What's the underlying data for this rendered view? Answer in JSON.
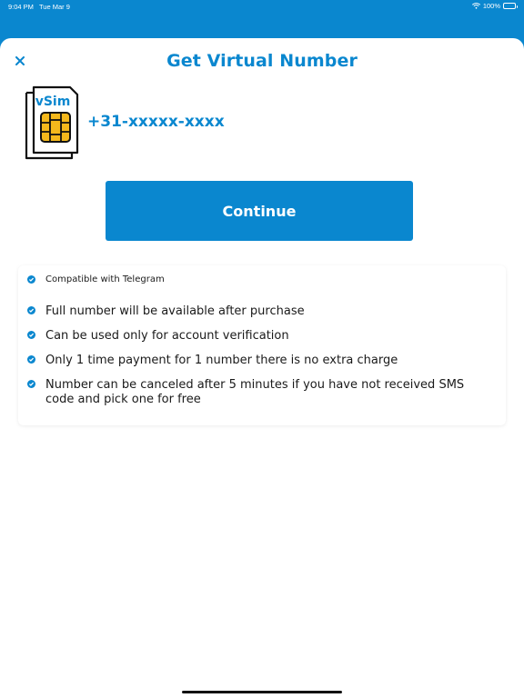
{
  "status_bar": {
    "time": "9:04 PM",
    "date": "Tue Mar 9",
    "battery": "100%",
    "icons": [
      "wifi-icon",
      "battery-icon"
    ]
  },
  "sheet": {
    "title": "Get Virtual Number",
    "close_icon": "close-icon",
    "sim_label": "vSim",
    "phone_number": "+31-xxxxx-xxxx",
    "continue_label": "Continue"
  },
  "features": [
    {
      "text": "Compatible with Telegram",
      "icon": "check-circle-icon"
    },
    {
      "text": "Full number will be available after purchase",
      "icon": "check-circle-icon"
    },
    {
      "text": "Can be used only for account verification",
      "icon": "check-circle-icon"
    },
    {
      "text": "Only 1 time payment for 1 number there is no extra charge",
      "icon": "check-circle-icon"
    },
    {
      "text": "Number can be canceled after 5 minutes if you have not received SMS code and pick one for free",
      "icon": "check-circle-icon"
    }
  ],
  "colors": {
    "accent": "#0a87cf",
    "sim_chip": "#f4b81c",
    "text": "#1a1a1a"
  }
}
